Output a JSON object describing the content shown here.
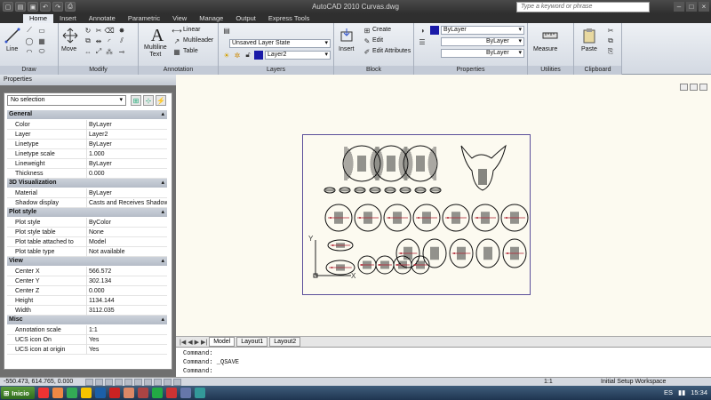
{
  "window": {
    "title": "AutoCAD 2010     Curvas.dwg",
    "search_placeholder": "Type a keyword or phrase"
  },
  "app_button": "A",
  "ribbon_tabs": [
    "Home",
    "Insert",
    "Annotate",
    "Parametric",
    "View",
    "Manage",
    "Output",
    "Express Tools"
  ],
  "ribbon": {
    "draw": {
      "title": "Draw",
      "line": "Line"
    },
    "modify": {
      "title": "Modify",
      "move": "Move"
    },
    "annotation": {
      "title": "Annotation",
      "text": "Multiline\nText",
      "linear": "Linear",
      "multileader": "Multileader",
      "table": "Table"
    },
    "layers": {
      "title": "Layers",
      "layer_state": "Unsaved Layer State",
      "layer": "Layer2"
    },
    "block": {
      "title": "Block",
      "insert": "Insert",
      "create": "Create",
      "edit": "Edit",
      "edit_attributes": "Edit Attributes"
    },
    "properties": {
      "title": "Properties",
      "color": "ByLayer",
      "linetype": "ByLayer",
      "lineweight": "ByLayer"
    },
    "utilities": {
      "title": "Utilities",
      "measure": "Measure"
    },
    "clipboard": {
      "title": "Clipboard",
      "paste": "Paste"
    }
  },
  "properties_palette": {
    "title": "Properties",
    "selection": "No selection",
    "sections": [
      {
        "name": "General",
        "rows": [
          {
            "k": "Color",
            "v": "ByLayer"
          },
          {
            "k": "Layer",
            "v": "Layer2"
          },
          {
            "k": "Linetype",
            "v": "ByLayer"
          },
          {
            "k": "Linetype scale",
            "v": "1.000"
          },
          {
            "k": "Lineweight",
            "v": "ByLayer"
          },
          {
            "k": "Thickness",
            "v": "0.000"
          }
        ]
      },
      {
        "name": "3D Visualization",
        "rows": [
          {
            "k": "Material",
            "v": "ByLayer"
          },
          {
            "k": "Shadow display",
            "v": "Casts and Receives Shadows"
          }
        ]
      },
      {
        "name": "Plot style",
        "rows": [
          {
            "k": "Plot style",
            "v": "ByColor"
          },
          {
            "k": "Plot style table",
            "v": "None"
          },
          {
            "k": "Plot table attached to",
            "v": "Model"
          },
          {
            "k": "Plot table type",
            "v": "Not available"
          }
        ]
      },
      {
        "name": "View",
        "rows": [
          {
            "k": "Center X",
            "v": "566.572"
          },
          {
            "k": "Center Y",
            "v": "302.134"
          },
          {
            "k": "Center Z",
            "v": "0.000"
          },
          {
            "k": "Height",
            "v": "1134.144"
          },
          {
            "k": "Width",
            "v": "3112.035"
          }
        ]
      },
      {
        "name": "Misc",
        "rows": [
          {
            "k": "Annotation scale",
            "v": "1:1"
          },
          {
            "k": "UCS icon On",
            "v": "Yes"
          },
          {
            "k": "UCS icon at origin",
            "v": "Yes"
          }
        ]
      }
    ]
  },
  "ucs": {
    "x": "X",
    "y": "Y"
  },
  "layout_tabs": [
    "Model",
    "Layout1",
    "Layout2"
  ],
  "command_lines": [
    "Command:",
    "Command: _QSAVE",
    "Command:"
  ],
  "status": {
    "coords": "-550.473, 614.765, 0.000",
    "scale": "1:1",
    "workspace": "Initial Setup Workspace"
  },
  "taskbar": {
    "start": "Inicio",
    "lang": "ES",
    "time": "15:34"
  },
  "colors": {
    "accent": "#b8161f",
    "paper": "#fcfaf0",
    "frame": "#5b4f9a",
    "mark": "#b02030"
  }
}
